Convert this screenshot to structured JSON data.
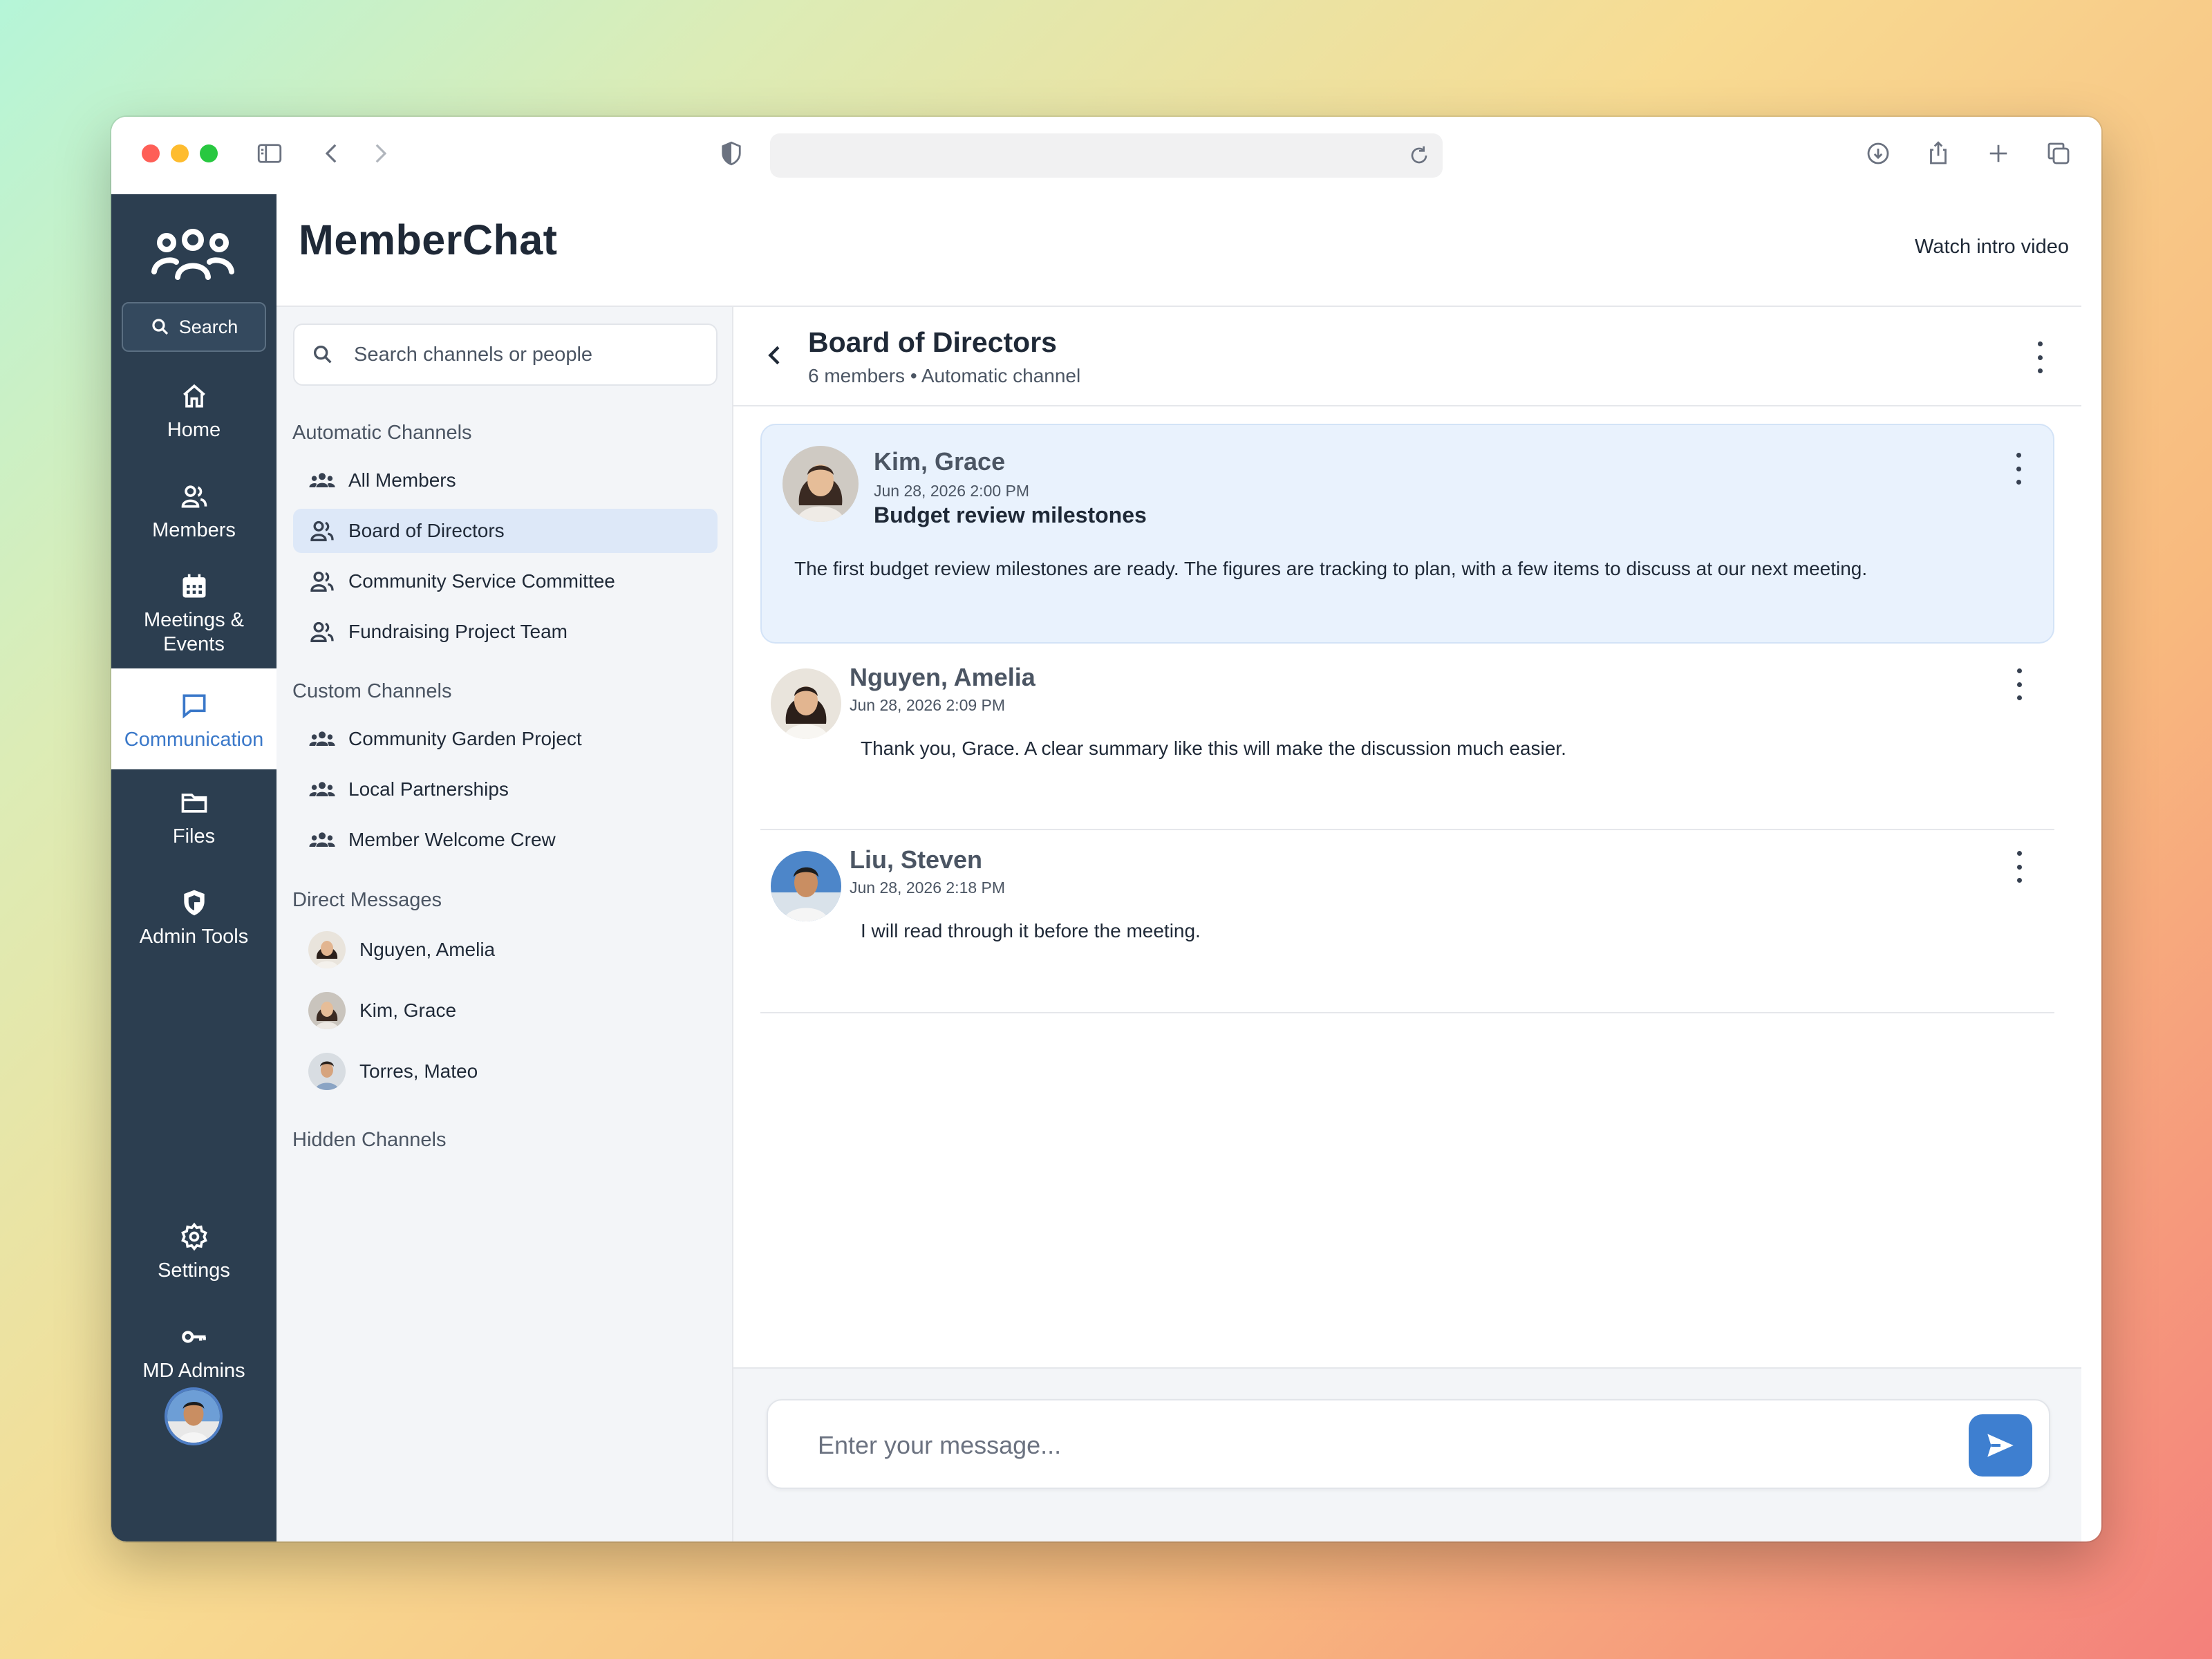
{
  "app": {
    "title": "MemberChat",
    "watch_video": "Watch intro video"
  },
  "sidebar": {
    "search_label": "Search",
    "items": [
      {
        "label": "Home",
        "icon": "home-icon"
      },
      {
        "label": "Members",
        "icon": "members-icon"
      },
      {
        "label": "Meetings & Events",
        "icon": "calendar-icon"
      },
      {
        "label": "Communication",
        "icon": "chat-icon",
        "active": true
      },
      {
        "label": "Files",
        "icon": "folder-icon"
      },
      {
        "label": "Admin Tools",
        "icon": "shield-icon"
      },
      {
        "label": "Settings",
        "icon": "gear-icon"
      },
      {
        "label": "MD Admins",
        "icon": "key-icon"
      }
    ]
  },
  "channels": {
    "search_placeholder": "Search channels or people",
    "automatic_title": "Automatic Channels",
    "automatic": [
      "All Members",
      "Board of Directors",
      "Community Service Committee",
      "Fundraising Project Team"
    ],
    "custom_title": "Custom Channels",
    "custom": [
      "Community Garden Project",
      "Local Partnerships",
      "Member Welcome Crew"
    ],
    "dm_title": "Direct Messages",
    "dms": [
      "Nguyen, Amelia",
      "Kim, Grace",
      "Torres, Mateo"
    ],
    "hidden_title": "Hidden Channels"
  },
  "conversation": {
    "title": "Board of Directors",
    "subtitle": "6 members • Automatic channel",
    "messages": [
      {
        "author": "Kim, Grace",
        "time": "Jun 28, 2026 2:00 PM",
        "subject": "Budget review milestones",
        "body": "The first budget review milestones are ready. The figures are tracking to plan, with a few items to discuss at our next meeting."
      },
      {
        "author": "Nguyen, Amelia",
        "time": "Jun 28, 2026 2:09 PM",
        "body": "Thank you, Grace. A clear summary like this will make the discussion much easier."
      },
      {
        "author": "Liu, Steven",
        "time": "Jun 28, 2026 2:18 PM",
        "body": "I will read through it before the meeting."
      }
    ],
    "composer_placeholder": "Enter your message..."
  },
  "colors": {
    "sidebar_bg": "#2c3e50",
    "accent": "#3e7fd0",
    "highlight_msg": "#e9f2fd",
    "selected_channel": "#dde8f8"
  }
}
